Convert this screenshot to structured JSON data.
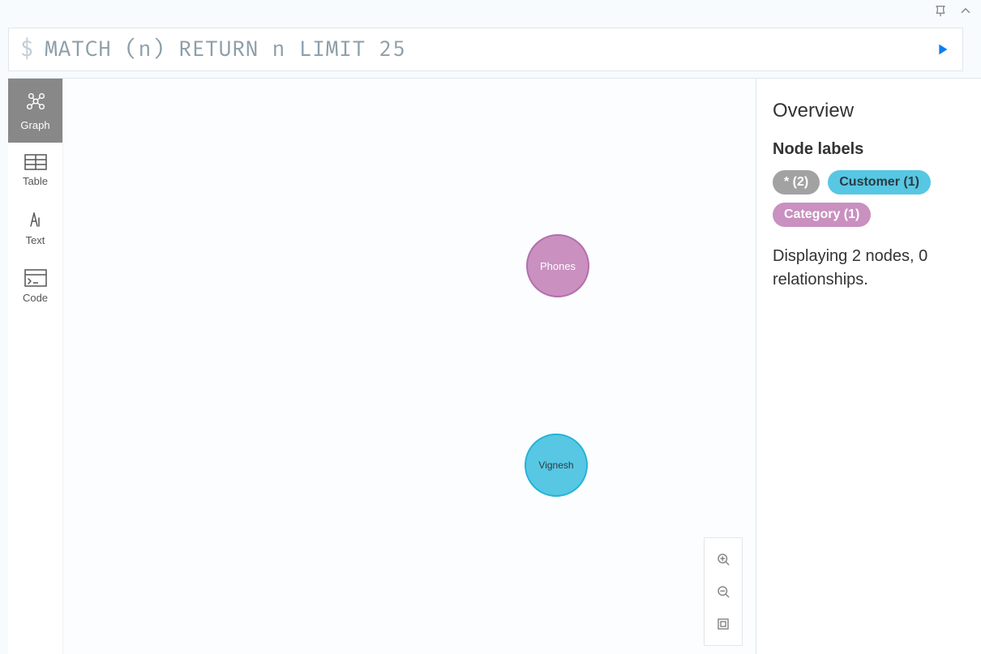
{
  "query": {
    "prompt": "$",
    "text": "MATCH (n) RETURN n LIMIT 25"
  },
  "view_tabs": {
    "graph": "Graph",
    "table": "Table",
    "text": "Text",
    "code": "Code"
  },
  "nodes": {
    "phones": "Phones",
    "vignesh": "Vignesh"
  },
  "overview": {
    "title": "Overview",
    "node_labels_header": "Node labels",
    "labels": {
      "all": "* (2)",
      "customer": "Customer (1)",
      "category": "Category (1)"
    },
    "status": "Displaying 2 nodes, 0 relationships."
  }
}
